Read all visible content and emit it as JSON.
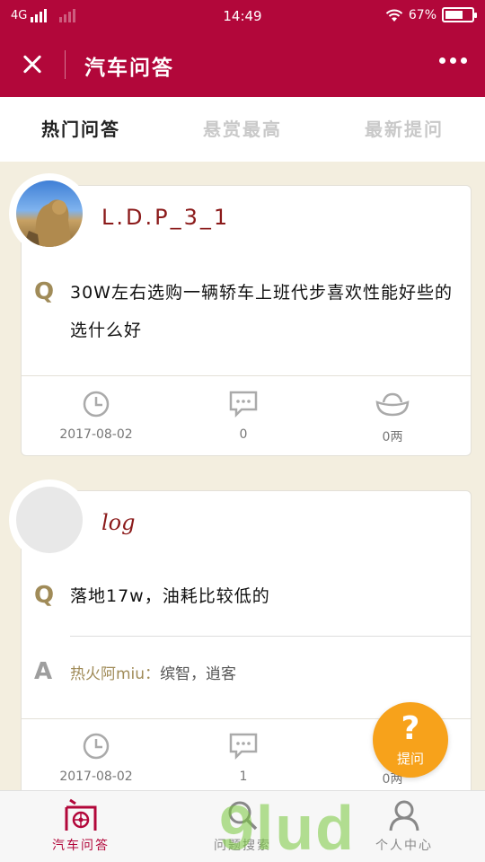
{
  "status_bar": {
    "network": "4G",
    "time": "14:49",
    "battery": "67%",
    "battery_level": 0.67
  },
  "app_bar": {
    "title": "汽车问答"
  },
  "tabs": [
    {
      "label": "热门问答",
      "active": true
    },
    {
      "label": "悬赏最高",
      "active": false
    },
    {
      "label": "最新提问",
      "active": false
    }
  ],
  "questions": [
    {
      "username": "L.D.P_3_1",
      "q_marker": "Q",
      "question": "30W左右选购一辆轿车上班代步喜欢性能好些的选什么好",
      "date": "2017-08-02",
      "comments": "0",
      "reward": "0两"
    },
    {
      "username": "log",
      "q_marker": "Q",
      "question": "落地17w，油耗比较低的",
      "a_marker": "A",
      "answer_author": "热火阿miu：",
      "answer_text": "缤智，逍客",
      "date": "2017-08-02",
      "comments": "1",
      "reward": "0两"
    }
  ],
  "ask_button": {
    "icon": "?",
    "label": "提问"
  },
  "bottom_nav": [
    {
      "label": "汽车问答",
      "icon": "qa-icon",
      "active": true
    },
    {
      "label": "问题搜索",
      "icon": "search-icon",
      "active": false
    },
    {
      "label": "个人中心",
      "icon": "user-icon",
      "active": false
    }
  ],
  "watermark": "9lud",
  "colors": {
    "brand": "#b2073a",
    "accent": "#f7a21b",
    "gold": "#a08b58"
  }
}
